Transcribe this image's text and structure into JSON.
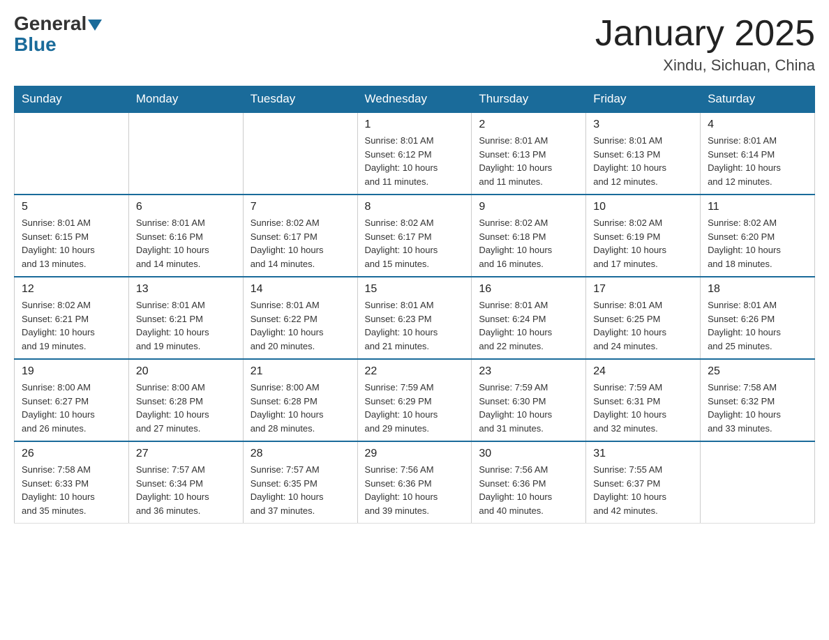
{
  "header": {
    "logo_general": "General",
    "logo_blue": "Blue",
    "month_title": "January 2025",
    "location": "Xindu, Sichuan, China"
  },
  "days_of_week": [
    "Sunday",
    "Monday",
    "Tuesday",
    "Wednesday",
    "Thursday",
    "Friday",
    "Saturday"
  ],
  "weeks": [
    [
      {
        "day": "",
        "info": ""
      },
      {
        "day": "",
        "info": ""
      },
      {
        "day": "",
        "info": ""
      },
      {
        "day": "1",
        "info": "Sunrise: 8:01 AM\nSunset: 6:12 PM\nDaylight: 10 hours\nand 11 minutes."
      },
      {
        "day": "2",
        "info": "Sunrise: 8:01 AM\nSunset: 6:13 PM\nDaylight: 10 hours\nand 11 minutes."
      },
      {
        "day": "3",
        "info": "Sunrise: 8:01 AM\nSunset: 6:13 PM\nDaylight: 10 hours\nand 12 minutes."
      },
      {
        "day": "4",
        "info": "Sunrise: 8:01 AM\nSunset: 6:14 PM\nDaylight: 10 hours\nand 12 minutes."
      }
    ],
    [
      {
        "day": "5",
        "info": "Sunrise: 8:01 AM\nSunset: 6:15 PM\nDaylight: 10 hours\nand 13 minutes."
      },
      {
        "day": "6",
        "info": "Sunrise: 8:01 AM\nSunset: 6:16 PM\nDaylight: 10 hours\nand 14 minutes."
      },
      {
        "day": "7",
        "info": "Sunrise: 8:02 AM\nSunset: 6:17 PM\nDaylight: 10 hours\nand 14 minutes."
      },
      {
        "day": "8",
        "info": "Sunrise: 8:02 AM\nSunset: 6:17 PM\nDaylight: 10 hours\nand 15 minutes."
      },
      {
        "day": "9",
        "info": "Sunrise: 8:02 AM\nSunset: 6:18 PM\nDaylight: 10 hours\nand 16 minutes."
      },
      {
        "day": "10",
        "info": "Sunrise: 8:02 AM\nSunset: 6:19 PM\nDaylight: 10 hours\nand 17 minutes."
      },
      {
        "day": "11",
        "info": "Sunrise: 8:02 AM\nSunset: 6:20 PM\nDaylight: 10 hours\nand 18 minutes."
      }
    ],
    [
      {
        "day": "12",
        "info": "Sunrise: 8:02 AM\nSunset: 6:21 PM\nDaylight: 10 hours\nand 19 minutes."
      },
      {
        "day": "13",
        "info": "Sunrise: 8:01 AM\nSunset: 6:21 PM\nDaylight: 10 hours\nand 19 minutes."
      },
      {
        "day": "14",
        "info": "Sunrise: 8:01 AM\nSunset: 6:22 PM\nDaylight: 10 hours\nand 20 minutes."
      },
      {
        "day": "15",
        "info": "Sunrise: 8:01 AM\nSunset: 6:23 PM\nDaylight: 10 hours\nand 21 minutes."
      },
      {
        "day": "16",
        "info": "Sunrise: 8:01 AM\nSunset: 6:24 PM\nDaylight: 10 hours\nand 22 minutes."
      },
      {
        "day": "17",
        "info": "Sunrise: 8:01 AM\nSunset: 6:25 PM\nDaylight: 10 hours\nand 24 minutes."
      },
      {
        "day": "18",
        "info": "Sunrise: 8:01 AM\nSunset: 6:26 PM\nDaylight: 10 hours\nand 25 minutes."
      }
    ],
    [
      {
        "day": "19",
        "info": "Sunrise: 8:00 AM\nSunset: 6:27 PM\nDaylight: 10 hours\nand 26 minutes."
      },
      {
        "day": "20",
        "info": "Sunrise: 8:00 AM\nSunset: 6:28 PM\nDaylight: 10 hours\nand 27 minutes."
      },
      {
        "day": "21",
        "info": "Sunrise: 8:00 AM\nSunset: 6:28 PM\nDaylight: 10 hours\nand 28 minutes."
      },
      {
        "day": "22",
        "info": "Sunrise: 7:59 AM\nSunset: 6:29 PM\nDaylight: 10 hours\nand 29 minutes."
      },
      {
        "day": "23",
        "info": "Sunrise: 7:59 AM\nSunset: 6:30 PM\nDaylight: 10 hours\nand 31 minutes."
      },
      {
        "day": "24",
        "info": "Sunrise: 7:59 AM\nSunset: 6:31 PM\nDaylight: 10 hours\nand 32 minutes."
      },
      {
        "day": "25",
        "info": "Sunrise: 7:58 AM\nSunset: 6:32 PM\nDaylight: 10 hours\nand 33 minutes."
      }
    ],
    [
      {
        "day": "26",
        "info": "Sunrise: 7:58 AM\nSunset: 6:33 PM\nDaylight: 10 hours\nand 35 minutes."
      },
      {
        "day": "27",
        "info": "Sunrise: 7:57 AM\nSunset: 6:34 PM\nDaylight: 10 hours\nand 36 minutes."
      },
      {
        "day": "28",
        "info": "Sunrise: 7:57 AM\nSunset: 6:35 PM\nDaylight: 10 hours\nand 37 minutes."
      },
      {
        "day": "29",
        "info": "Sunrise: 7:56 AM\nSunset: 6:36 PM\nDaylight: 10 hours\nand 39 minutes."
      },
      {
        "day": "30",
        "info": "Sunrise: 7:56 AM\nSunset: 6:36 PM\nDaylight: 10 hours\nand 40 minutes."
      },
      {
        "day": "31",
        "info": "Sunrise: 7:55 AM\nSunset: 6:37 PM\nDaylight: 10 hours\nand 42 minutes."
      },
      {
        "day": "",
        "info": ""
      }
    ]
  ]
}
